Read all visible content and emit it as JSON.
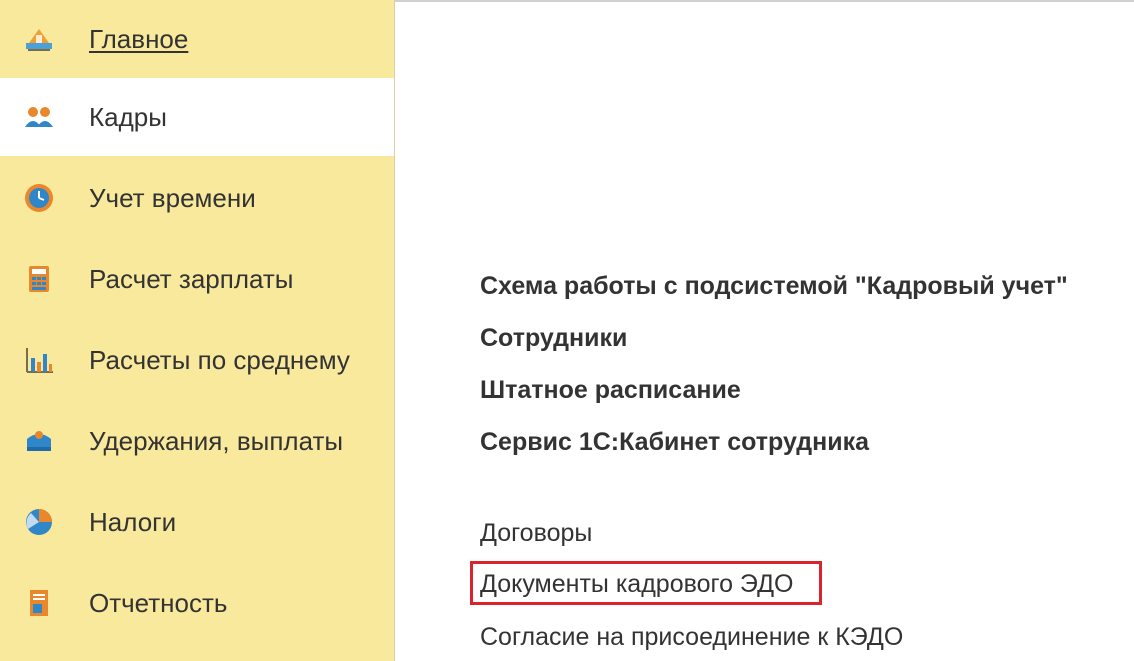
{
  "sidebar": {
    "items": [
      {
        "label": "Главное",
        "icon": "home-icon",
        "active": false
      },
      {
        "label": "Кадры",
        "icon": "people-icon",
        "active": true
      },
      {
        "label": "Учет времени",
        "icon": "clock-icon",
        "active": false
      },
      {
        "label": "Расчет зарплаты",
        "icon": "calculator-icon",
        "active": false
      },
      {
        "label": "Расчеты по среднему",
        "icon": "bar-chart-icon",
        "active": false
      },
      {
        "label": "Удержания, выплаты",
        "icon": "wallet-icon",
        "active": false
      },
      {
        "label": "Налоги",
        "icon": "pie-chart-icon",
        "active": false
      },
      {
        "label": "Отчетность",
        "icon": "report-icon",
        "active": false
      }
    ]
  },
  "main": {
    "bold_links": [
      "Схема работы с подсистемой \"Кадровый учет\"",
      "Сотрудники",
      "Штатное расписание",
      "Сервис 1С:Кабинет сотрудника"
    ],
    "links": [
      "Договоры",
      "Документы кадрового ЭДО",
      "Согласие на присоединение к КЭДО"
    ]
  },
  "colors": {
    "sidebar_bg": "#f9e99c",
    "highlight": "#d9242b",
    "text": "#333333"
  }
}
